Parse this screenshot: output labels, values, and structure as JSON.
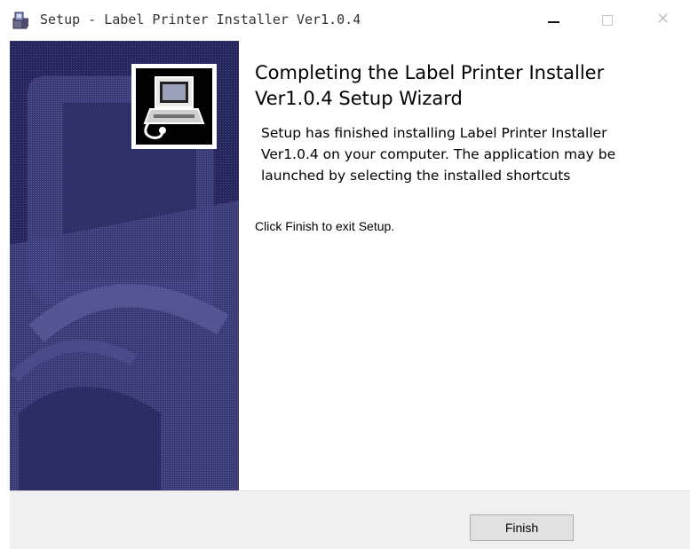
{
  "window": {
    "title": "Setup - Label Printer Installer Ver1.0.4",
    "app_icon": "installer-icon",
    "controls": [
      "minimize-icon",
      "maximize-icon",
      "close-icon"
    ]
  },
  "banner": {
    "logo_icon": "computer-install-icon",
    "background_color": "#26265c"
  },
  "content": {
    "heading": "Completing the Label Printer Installer Ver1.0.4 Setup Wizard",
    "message": "Setup has finished installing Label Printer Installer Ver1.0.4 on your computer. The application may be launched by selecting the installed shortcuts",
    "exit_instruction": "Click Finish to exit Setup."
  },
  "footer": {
    "finish_label": "Finish"
  }
}
